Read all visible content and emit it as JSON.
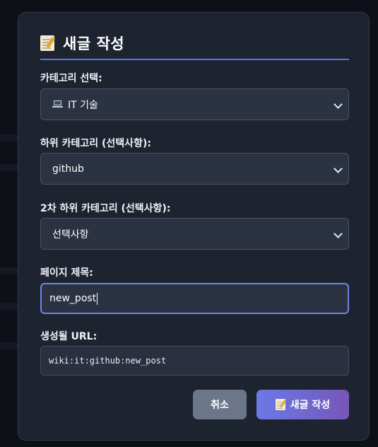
{
  "modal": {
    "title": "새글 작성",
    "title_icon": "memo-icon"
  },
  "form": {
    "category": {
      "label": "카테고리 선택:",
      "selected": "IT 기술",
      "option_icon": "laptop-icon"
    },
    "subcategory": {
      "label": "하위 카테고리 (선택사항):",
      "selected": "github"
    },
    "subcategory2": {
      "label": "2차 하위 카테고리 (선택사항):",
      "selected": "선택사항"
    },
    "page_title": {
      "label": "페이지 제목:",
      "value": "new_post"
    },
    "generated_url": {
      "label": "생성될 URL:",
      "value": "wiki:it:github:new_post"
    }
  },
  "buttons": {
    "cancel_label": "취소",
    "submit_label": "새글 작성",
    "submit_icon": "memo-icon"
  },
  "colors": {
    "modal_bg": "#1e2330",
    "accent": "#5b73e8",
    "input_bg": "#2b3242",
    "cancel_bg": "#6b7689",
    "submit_gradient_start": "#6b7ae6",
    "submit_gradient_end": "#7657b8"
  }
}
